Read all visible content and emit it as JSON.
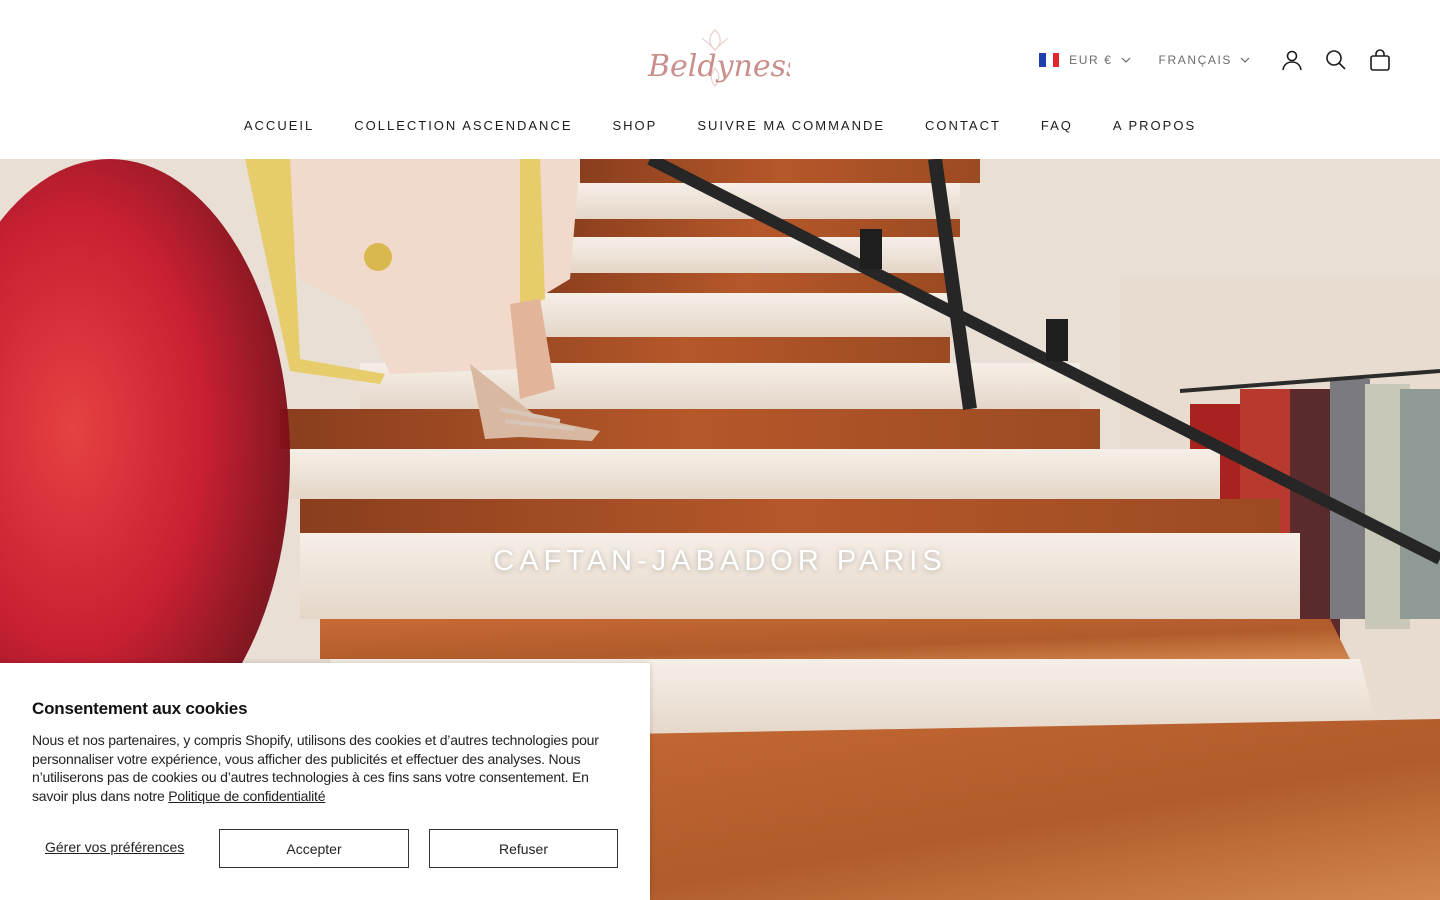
{
  "header": {
    "logo_text": "Beldyness",
    "currency": {
      "flag": "france-flag",
      "label": "EUR €"
    },
    "language": {
      "label": "FRANÇAIS"
    },
    "icons": [
      "account-icon",
      "search-icon",
      "cart-bag-icon"
    ]
  },
  "nav": {
    "items": [
      {
        "label": "ACCUEIL"
      },
      {
        "label": "COLLECTION ASCENDANCE"
      },
      {
        "label": "SHOP"
      },
      {
        "label": "SUIVRE MA COMMANDE"
      },
      {
        "label": "CONTACT"
      },
      {
        "label": "FAQ"
      },
      {
        "label": "A PROPOS"
      }
    ]
  },
  "hero": {
    "title": "CAFTAN-JABADOR PARIS",
    "image": "woman-in-caftan-descending-wooden-staircase"
  },
  "cookie": {
    "title": "Consentement aux cookies",
    "text": "Nous et nos partenaires, y compris Shopify, utilisons des cookies et d’autres technologies pour personnaliser votre expérience, vous afficher des publicités et effectuer des analyses. Nous n’utiliserons pas de cookies ou d’autres technologies à ces fins sans votre consentement. En savoir plus dans notre ",
    "privacy_link": "Politique de confidentialité",
    "prefs_label": "Gérer vos préférences",
    "accept_label": "Accepter",
    "refuse_label": "Refuser"
  },
  "colors": {
    "logo": "#c98f8a",
    "text": "#1c1c1c",
    "muted": "#6b6b6b"
  }
}
